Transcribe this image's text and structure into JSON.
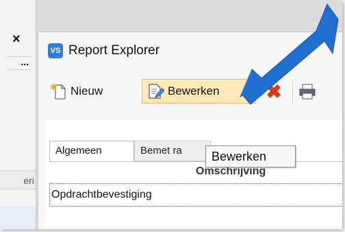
{
  "background_window": {
    "close_glyph": "×",
    "dots": "...",
    "tab_fragment": "eri"
  },
  "dialog": {
    "title": "Report Explorer",
    "app_icon": "VS"
  },
  "toolbar": {
    "new_label": "Nieuw",
    "edit_label": "Bewerken",
    "delete_glyph": "✖"
  },
  "tabs": [
    {
      "label": "Algemeen",
      "active": true
    },
    {
      "label": "Bemet ra",
      "active": false
    }
  ],
  "table": {
    "column_header": "Omschrijving",
    "rows": [
      "Opdrachtbevestiging"
    ]
  },
  "tooltip": {
    "text": "Bewerken"
  },
  "colors": {
    "accent_blue": "#1f6fd1",
    "edit_highlight": "#fde9b8",
    "delete_red": "#d73c1f"
  },
  "icons": {
    "app": "vs-app-icon",
    "new": "new-document-icon",
    "edit": "edit-document-icon",
    "delete": "delete-x-icon",
    "print": "printer-icon",
    "annotation": "arrow-pointer"
  }
}
